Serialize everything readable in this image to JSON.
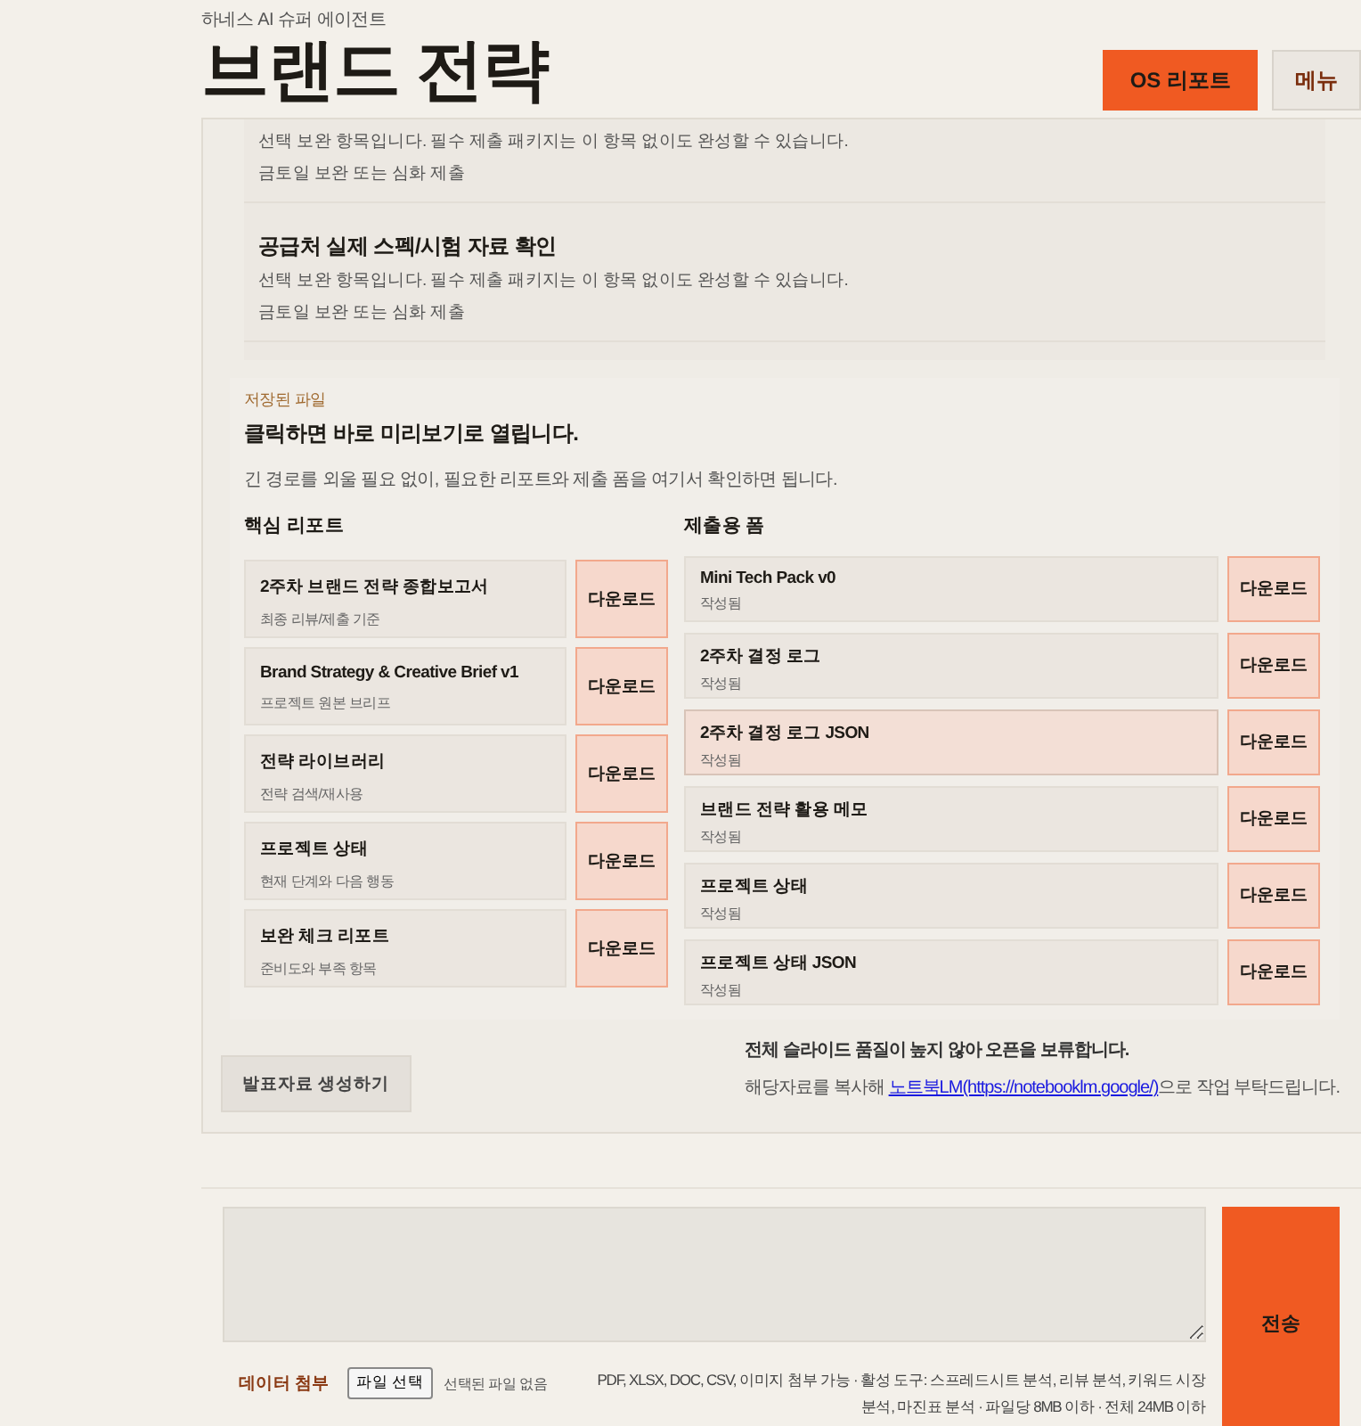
{
  "header": {
    "eyebrow": "하네스 AI 슈퍼 에이전트",
    "title": "브랜드 전략",
    "buttons": [
      {
        "label": "OS 리포트",
        "kind": "primary"
      },
      {
        "label": "메뉴",
        "kind": "secondary"
      }
    ]
  },
  "tasks": [
    {
      "description": "선택 보완 항목입니다. 필수 제출 패키지는 이 항목 없이도 완성할 수 있습니다.",
      "note": "금토일 보완 또는 심화 제출"
    },
    {
      "title": "공급처 실제 스펙/시험 자료 확인",
      "description": "선택 보완 항목입니다. 필수 제출 패키지는 이 항목 없이도 완성할 수 있습니다.",
      "note": "금토일 보완 또는 심화 제출"
    }
  ],
  "files": {
    "eyebrow": "저장된 파일",
    "heading": "클릭하면 바로 미리보기로 열립니다.",
    "description": "긴 경로를 외울 필요 없이, 필요한 리포트와 제출 폼을 여기서 확인하면 됩니다.",
    "columns": [
      {
        "title": "핵심 리포트",
        "items": [
          {
            "name": "2주차 브랜드 전략 종합보고서",
            "meta": "최종 리뷰/제출 기준",
            "action": "다운로드",
            "selected": false
          },
          {
            "name": "Brand Strategy & Creative Brief v1",
            "meta": "프로젝트 원본 브리프",
            "action": "다운로드",
            "selected": false
          },
          {
            "name": "전략 라이브러리",
            "meta": "전략 검색/재사용",
            "action": "다운로드",
            "selected": false
          },
          {
            "name": "프로젝트 상태",
            "meta": "현재 단계와 다음 행동",
            "action": "다운로드",
            "selected": false
          },
          {
            "name": "보완 체크 리포트",
            "meta": "준비도와 부족 항목",
            "action": "다운로드",
            "selected": false
          }
        ]
      },
      {
        "title": "제출용 폼",
        "items": [
          {
            "name": "Mini Tech Pack v0",
            "meta": "작성됨",
            "action": "다운로드",
            "selected": false
          },
          {
            "name": "2주차 결정 로그",
            "meta": "작성됨",
            "action": "다운로드",
            "selected": false
          },
          {
            "name": "2주차 결정 로그 JSON",
            "meta": "작성됨",
            "action": "다운로드",
            "selected": true
          },
          {
            "name": "브랜드 전략 활용 메모",
            "meta": "작성됨",
            "action": "다운로드",
            "selected": false
          },
          {
            "name": "프로젝트 상태",
            "meta": "작성됨",
            "action": "다운로드",
            "selected": false
          },
          {
            "name": "프로젝트 상태 JSON",
            "meta": "작성됨",
            "action": "다운로드",
            "selected": false
          }
        ]
      }
    ]
  },
  "slides": {
    "button": "발표자료 생성하기",
    "notice": "전체 슬라이드 품질이 높지 않아 오픈을 보류합니다.",
    "hint_before": "해당자료를 복사해 ",
    "link": "노트북LM(https://notebooklm.google/)",
    "hint_after": "으로 작업 부탁드립니다."
  },
  "composer": {
    "send": "전송",
    "attach_label": "데이터 첨부",
    "file_button": "파일 선택",
    "file_status": "선택된 파일 없음",
    "help": "PDF, XLSX, DOC, CSV, 이미지 첨부 가능 · 활성 도구: 스프레드시트 분석, 리뷰 분석, 키워드 시장 분석, 마진표 분석 · 파일당 8MB 이하 · 전체 24MB 이하"
  }
}
